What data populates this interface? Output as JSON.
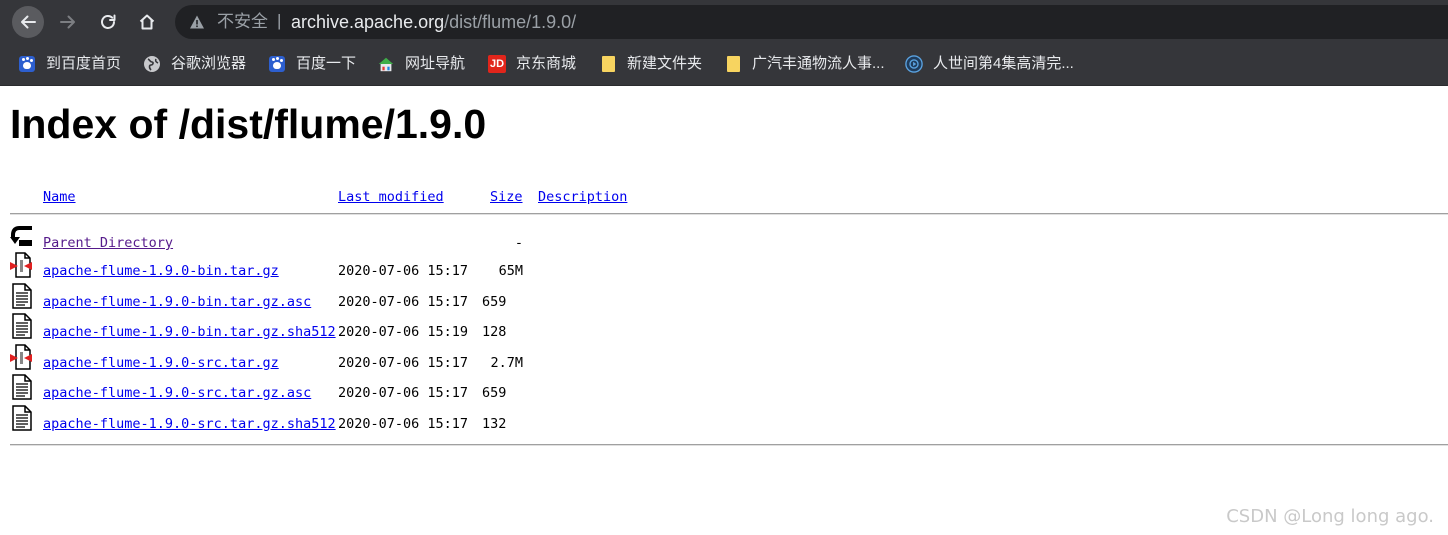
{
  "browser": {
    "security_label": "不安全",
    "separator": "|",
    "url_host": "archive.apache.org",
    "url_path": "/dist/flume/1.9.0/"
  },
  "bookmarks": [
    {
      "label": "到百度首页",
      "icon": "baidu-paw-icon"
    },
    {
      "label": "谷歌浏览器",
      "icon": "globe-icon"
    },
    {
      "label": "百度一下",
      "icon": "baidu-paw-icon"
    },
    {
      "label": "网址导航",
      "icon": "house-icon"
    },
    {
      "label": "京东商城",
      "icon": "jd-icon",
      "icon_text": "JD"
    },
    {
      "label": "新建文件夹",
      "icon": "folder-icon"
    },
    {
      "label": "广汽丰通物流人事...",
      "icon": "folder-icon"
    },
    {
      "label": "人世间第4集高清完...",
      "icon": "video-icon"
    }
  ],
  "page": {
    "title": "Index of /dist/flume/1.9.0",
    "columns": {
      "name": "Name",
      "last_modified": "Last modified",
      "size": "Size",
      "description": "Description"
    },
    "parent": {
      "name": "Parent Directory",
      "size": "-"
    },
    "files": [
      {
        "name": "apache-flume-1.9.0-bin.tar.gz",
        "modified": "2020-07-06 15:17",
        "size": "65M",
        "icon": "compressed-file-icon"
      },
      {
        "name": "apache-flume-1.9.0-bin.tar.gz.asc",
        "modified": "2020-07-06 15:17",
        "size": "659",
        "icon": "text-file-icon"
      },
      {
        "name": "apache-flume-1.9.0-bin.tar.gz.sha512",
        "modified": "2020-07-06 15:19",
        "size": "128",
        "icon": "text-file-icon"
      },
      {
        "name": "apache-flume-1.9.0-src.tar.gz",
        "modified": "2020-07-06 15:17",
        "size": "2.7M",
        "icon": "compressed-file-icon"
      },
      {
        "name": "apache-flume-1.9.0-src.tar.gz.asc",
        "modified": "2020-07-06 15:17",
        "size": "659",
        "icon": "text-file-icon"
      },
      {
        "name": "apache-flume-1.9.0-src.tar.gz.sha512",
        "modified": "2020-07-06 15:17",
        "size": "132",
        "icon": "text-file-icon"
      }
    ]
  },
  "watermark": "CSDN @Long long ago."
}
